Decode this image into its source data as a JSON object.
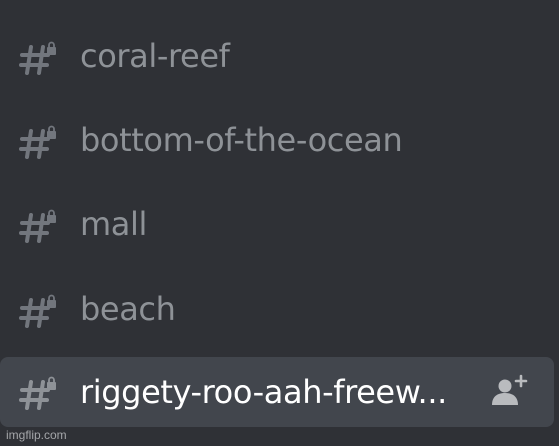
{
  "channels": [
    {
      "name": "coral-reef",
      "icon": "locked-text-channel-icon",
      "active": false
    },
    {
      "name": "bottom-of-the-ocean",
      "icon": "locked-text-channel-icon",
      "active": false
    },
    {
      "name": "mall",
      "icon": "locked-text-channel-icon",
      "active": false
    },
    {
      "name": "beach",
      "icon": "locked-text-channel-icon",
      "active": false
    },
    {
      "name": "riggety-roo-aah-freew...",
      "icon": "locked-text-channel-icon",
      "active": true,
      "action_icon": "create-invite-icon"
    }
  ],
  "watermark": "imgflip.com",
  "colors": {
    "background": "#2f3136",
    "active_background": "#42464d",
    "muted_text": "#8e9297",
    "active_text": "#ffffff"
  }
}
